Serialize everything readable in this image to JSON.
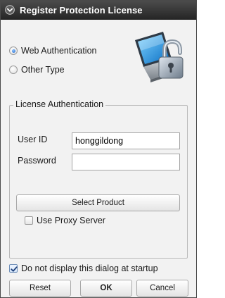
{
  "window": {
    "title": "Register Protection License",
    "title_icon": "chevron-down-circle-icon"
  },
  "auth_type": {
    "options": [
      {
        "label": "Web Authentication",
        "selected": true
      },
      {
        "label": "Other Type",
        "selected": false
      }
    ]
  },
  "logo": {
    "icon": "laptop-padlock-icon"
  },
  "license": {
    "legend": "License Authentication",
    "user_id_label": "User ID",
    "user_id_value": "honggildong",
    "password_label": "Password",
    "password_value": "",
    "select_product_label": "Select Product",
    "use_proxy_label": "Use Proxy Server",
    "use_proxy_checked": false
  },
  "footer": {
    "do_not_display_label": "Do not display this dialog at startup",
    "do_not_display_checked": true,
    "reset_label": "Reset",
    "ok_label": "OK",
    "cancel_label": "Cancel"
  },
  "colors": {
    "titlebar": "#333333",
    "accent": "#1e63c8",
    "background": "#f2f2f2"
  }
}
